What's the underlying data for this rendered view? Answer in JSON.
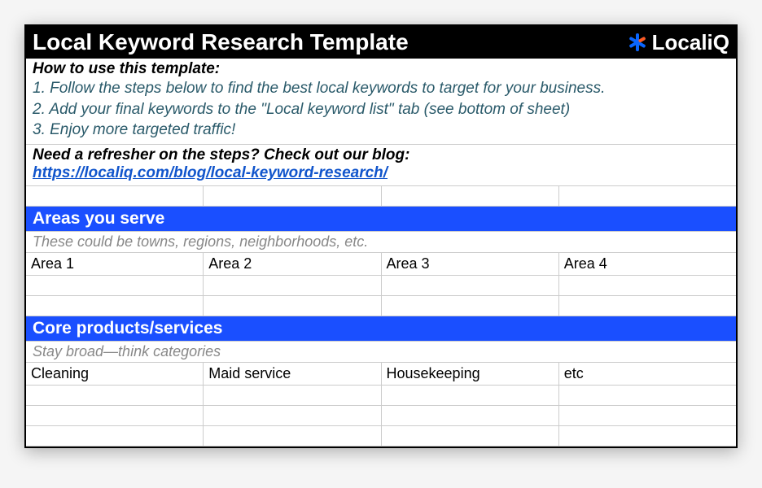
{
  "header": {
    "title": "Local Keyword Research Template",
    "logo_text": "LocaliQ"
  },
  "instructions": {
    "heading": "How to use this template:",
    "steps": [
      "1. Follow the steps below to find the best local keywords to target for your business.",
      "2. Add your final keywords to the \"Local keyword list\" tab (see bottom of sheet)",
      "3. Enjoy more targeted traffic!"
    ]
  },
  "refresher": {
    "heading": "Need a refresher on the steps? Check out our blog:",
    "link": "https://localiq.com/blog/local-keyword-research/"
  },
  "sections": {
    "areas": {
      "title": "Areas you serve",
      "hint": "These could be towns, regions, neighborhoods, etc.",
      "cells": [
        "Area 1",
        "Area 2",
        "Area 3",
        "Area 4"
      ]
    },
    "products": {
      "title": "Core products/services",
      "hint": "Stay broad—think categories",
      "cells": [
        "Cleaning",
        "Maid service",
        "Housekeeping",
        "etc"
      ]
    }
  }
}
